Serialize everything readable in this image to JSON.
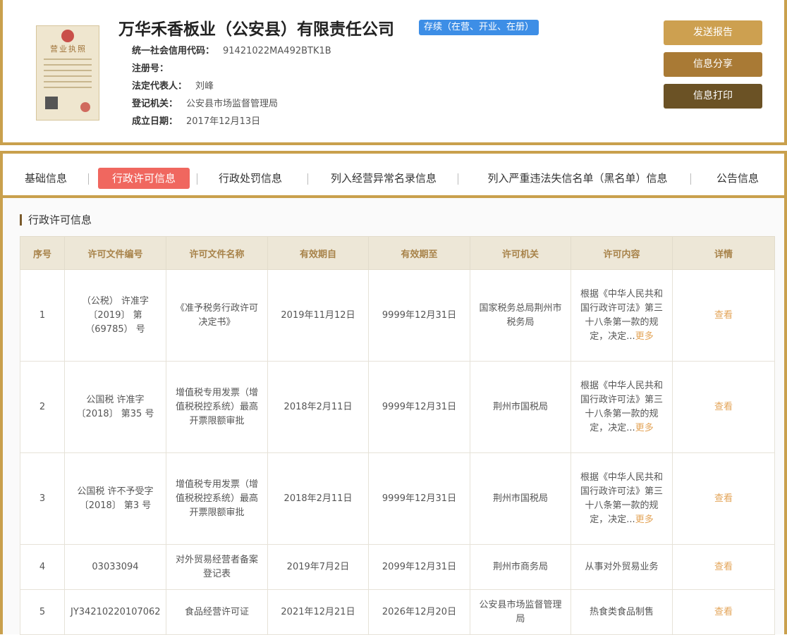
{
  "company": {
    "name": "万华禾香板业（公安县）有限责任公司",
    "status": "存续（在营、开业、在册）",
    "license_image_title": "营业执照",
    "fields": [
      {
        "label": "统一社会信用代码：",
        "value": "91421022MA492BTK1B"
      },
      {
        "label": "注册号：",
        "value": ""
      },
      {
        "label": "法定代表人：",
        "value": "刘峰"
      },
      {
        "label": "登记机关：",
        "value": "公安县市场监督管理局"
      },
      {
        "label": "成立日期：",
        "value": "2017年12月13日"
      }
    ]
  },
  "actions": {
    "send_report": "发送报告",
    "share": "信息分享",
    "print": "信息打印"
  },
  "tabs": [
    {
      "label": "基础信息"
    },
    {
      "label": "行政许可信息",
      "active": true
    },
    {
      "label": "行政处罚信息"
    },
    {
      "label": "列入经营异常名录信息"
    },
    {
      "label": "列入严重违法失信名单（黑名单）信息"
    },
    {
      "label": "公告信息"
    }
  ],
  "section_title": "行政许可信息",
  "table": {
    "headers": [
      "序号",
      "许可文件编号",
      "许可文件名称",
      "有效期自",
      "有效期至",
      "许可机关",
      "许可内容",
      "详情"
    ],
    "rows": [
      {
        "no": "1",
        "doc_no": "（公税） 许准字〔2019〕 第（69785） 号",
        "doc_name": "《准予税务行政许可决定书》",
        "from": "2019年11月12日",
        "to": "9999年12月31日",
        "authority": "国家税务总局荆州市税务局",
        "content": "根据《中华人民共和国行政许可法》第三十八条第一款的规定，决定...",
        "more": "更多",
        "detail": "查看"
      },
      {
        "no": "2",
        "doc_no": "公国税 许准字 〔2018〕 第35 号",
        "doc_name": "增值税专用发票（增值税税控系统）最高开票限额审批",
        "from": "2018年2月11日",
        "to": "9999年12月31日",
        "authority": "荆州市国税局",
        "content": "根据《中华人民共和国行政许可法》第三十八条第一款的规定，决定...",
        "more": "更多",
        "detail": "查看"
      },
      {
        "no": "3",
        "doc_no": "公国税 许不予受字〔2018〕 第3 号",
        "doc_name": "增值税专用发票（增值税税控系统）最高开票限额审批",
        "from": "2018年2月11日",
        "to": "9999年12月31日",
        "authority": "荆州市国税局",
        "content": "根据《中华人民共和国行政许可法》第三十八条第一款的规定，决定...",
        "more": "更多",
        "detail": "查看"
      },
      {
        "no": "4",
        "doc_no": "03033094",
        "doc_name": "对外贸易经营者备案登记表",
        "from": "2019年7月2日",
        "to": "2099年12月31日",
        "authority": "荆州市商务局",
        "content": "从事对外贸易业务",
        "more": "",
        "detail": "查看"
      },
      {
        "no": "5",
        "doc_no": "JY34210220107062",
        "doc_name": "食品经营许可证",
        "from": "2021年12月21日",
        "to": "2026年12月20日",
        "authority": "公安县市场监督管理局",
        "content": "热食类食品制售",
        "more": "",
        "detail": "查看"
      }
    ]
  },
  "colors": {
    "gold_border": "#c9a04d",
    "status_blue": "#3d8ee6",
    "active_tab": "#f0675f",
    "link": "#e3a458",
    "header_bg": "#ede7d7"
  }
}
